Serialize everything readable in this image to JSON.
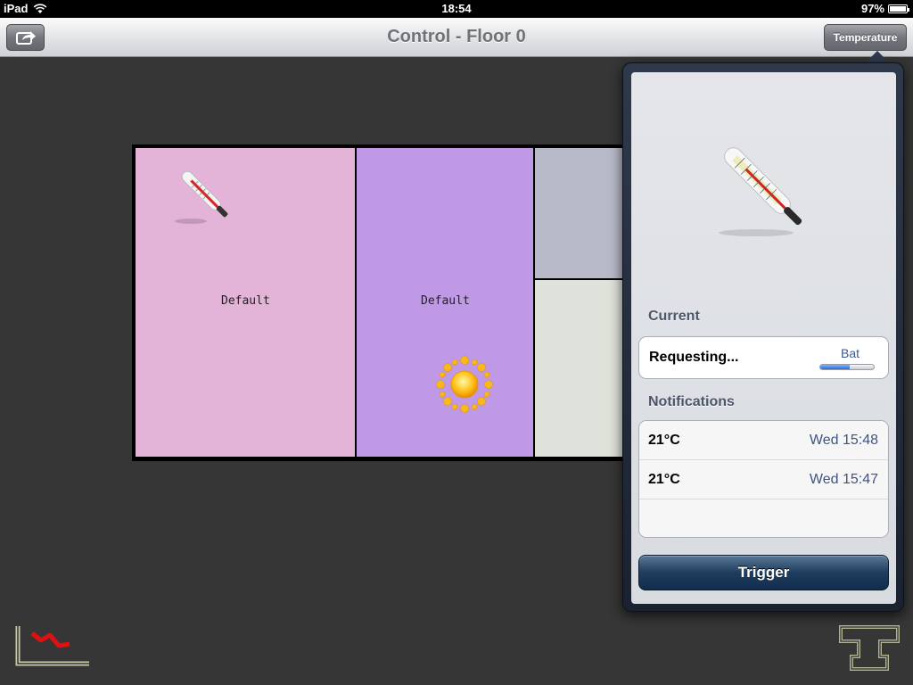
{
  "status_bar": {
    "device": "iPad",
    "time": "18:54",
    "battery": "97%"
  },
  "nav": {
    "title": "Control - Floor 0",
    "temperature_button": "Temperature",
    "share_icon": "share-icon"
  },
  "floorplan": {
    "rooms": [
      {
        "label": "Default",
        "color": "#e3b3d8",
        "icon": "thermometer-icon"
      },
      {
        "label": "Default",
        "color": "#bf99e6",
        "icon": "sun-icon"
      },
      {
        "label": "",
        "color": "#b8b9c8"
      },
      {
        "label": "",
        "color": "#dfe2da"
      }
    ]
  },
  "popover": {
    "current_title": "Current",
    "current_status": "Requesting...",
    "battery_label": "Bat",
    "battery_level": 0.55,
    "notifications_title": "Notifications",
    "notifications": [
      {
        "value": "21°C",
        "time": "Wed 15:48"
      },
      {
        "value": "21°C",
        "time": "Wed 15:47"
      }
    ],
    "trigger_label": "Trigger"
  },
  "bottom": {
    "left_icon": "chart-icon",
    "right_icon": "t-logo-icon"
  }
}
